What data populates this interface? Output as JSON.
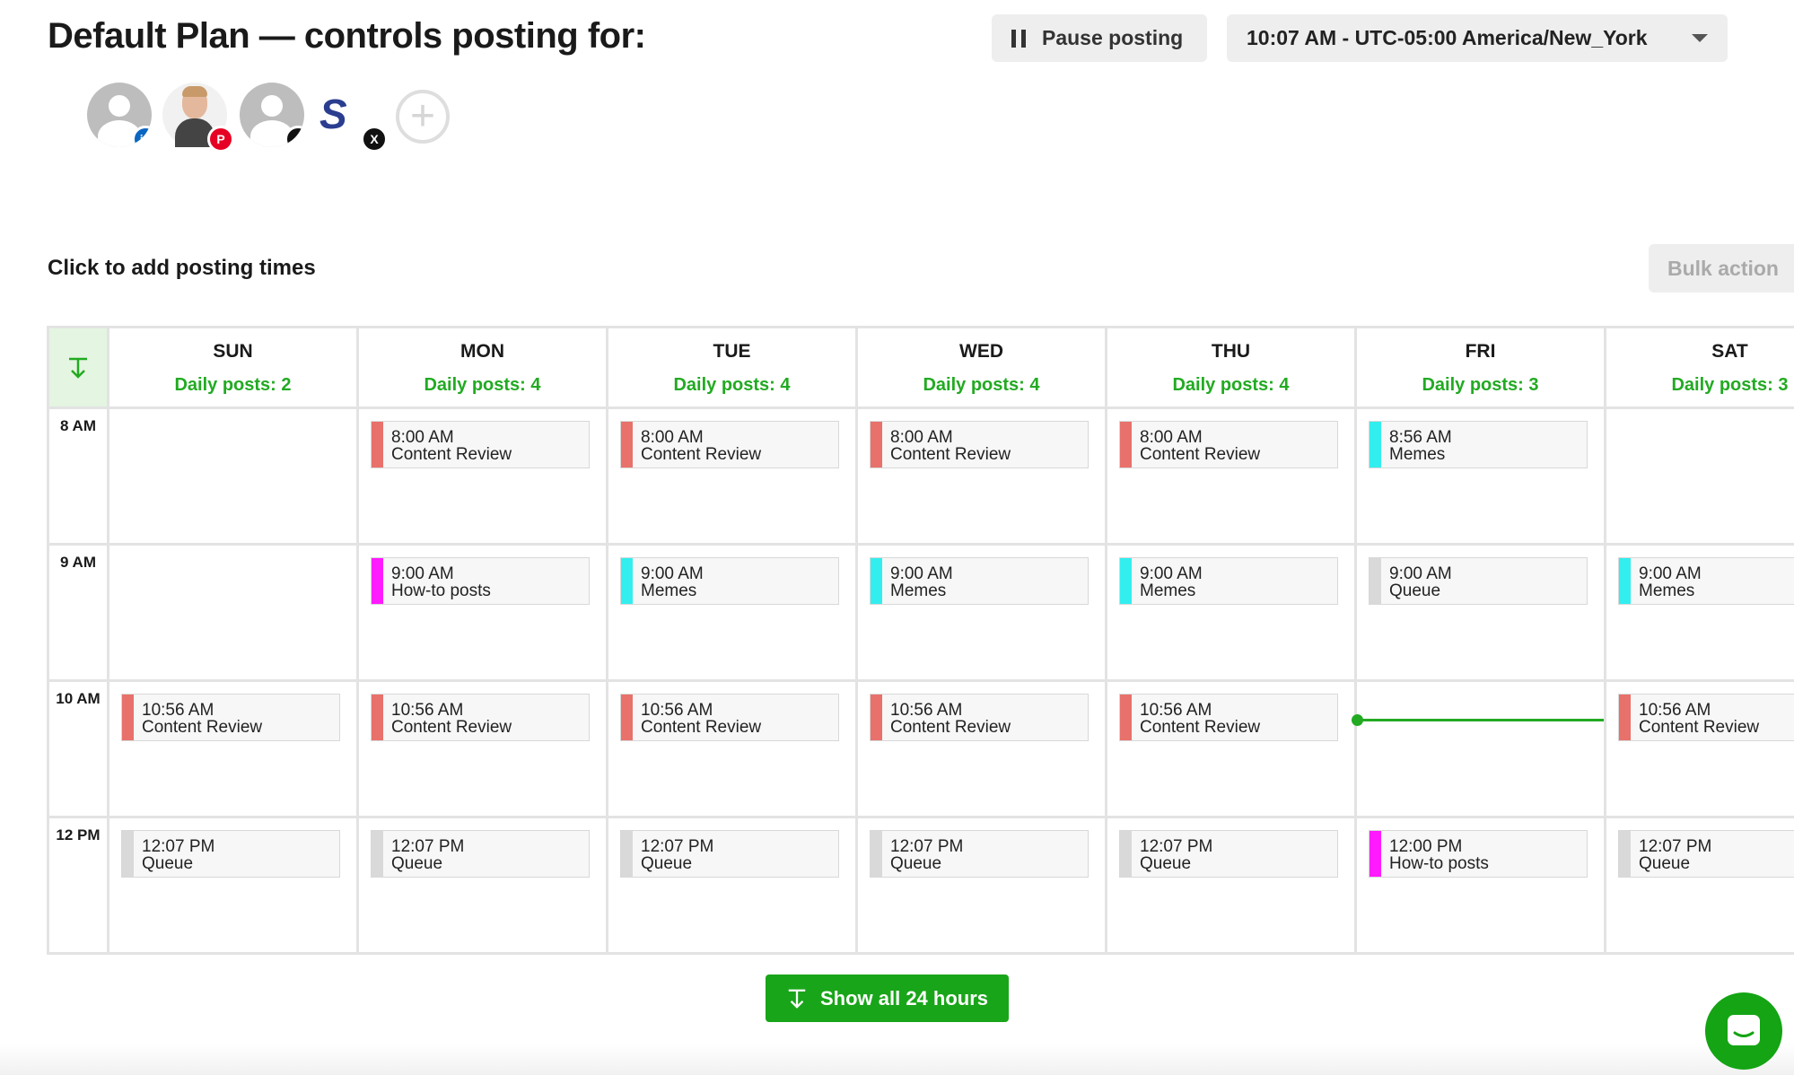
{
  "header": {
    "title": "Default Plan — controls posting for:",
    "pause_label": "Pause posting",
    "timezone": "10:07 AM - UTC-05:00 America/New_York"
  },
  "accounts": [
    {
      "kind": "generic",
      "network": "linkedin",
      "badge_text": "in",
      "badge_color": "#0a66c2"
    },
    {
      "kind": "photo",
      "network": "pinterest",
      "badge_text": "P",
      "badge_color": "#e60023"
    },
    {
      "kind": "generic",
      "network": "tiktok",
      "badge_text": "♪",
      "badge_color": "#111111"
    },
    {
      "kind": "logo",
      "network": "x",
      "badge_text": "X",
      "badge_color": "#111111"
    }
  ],
  "subtitle": "Click to add posting times",
  "bulk_label": "Bulk action",
  "hours": [
    "8 AM",
    "9 AM",
    "10 AM",
    "12 PM"
  ],
  "days": [
    {
      "name": "SUN",
      "daily": "Daily posts: 2",
      "slots": [
        null,
        null,
        {
          "time": "10:56 AM",
          "label": "Content Review",
          "color": "#e8716b"
        },
        {
          "time": "12:07 PM",
          "label": "Queue",
          "color": "#d9d9d9"
        }
      ]
    },
    {
      "name": "MON",
      "daily": "Daily posts: 4",
      "slots": [
        {
          "time": "8:00 AM",
          "label": "Content Review",
          "color": "#e8716b"
        },
        {
          "time": "9:00 AM",
          "label": "How-to posts",
          "color": "#ff1aff"
        },
        {
          "time": "10:56 AM",
          "label": "Content Review",
          "color": "#e8716b"
        },
        {
          "time": "12:07 PM",
          "label": "Queue",
          "color": "#d9d9d9"
        }
      ]
    },
    {
      "name": "TUE",
      "daily": "Daily posts: 4",
      "slots": [
        {
          "time": "8:00 AM",
          "label": "Content Review",
          "color": "#e8716b"
        },
        {
          "time": "9:00 AM",
          "label": "Memes",
          "color": "#33eeee"
        },
        {
          "time": "10:56 AM",
          "label": "Content Review",
          "color": "#e8716b"
        },
        {
          "time": "12:07 PM",
          "label": "Queue",
          "color": "#d9d9d9"
        }
      ]
    },
    {
      "name": "WED",
      "daily": "Daily posts: 4",
      "slots": [
        {
          "time": "8:00 AM",
          "label": "Content Review",
          "color": "#e8716b"
        },
        {
          "time": "9:00 AM",
          "label": "Memes",
          "color": "#33eeee"
        },
        {
          "time": "10:56 AM",
          "label": "Content Review",
          "color": "#e8716b"
        },
        {
          "time": "12:07 PM",
          "label": "Queue",
          "color": "#d9d9d9"
        }
      ]
    },
    {
      "name": "THU",
      "daily": "Daily posts: 4",
      "slots": [
        {
          "time": "8:00 AM",
          "label": "Content Review",
          "color": "#e8716b"
        },
        {
          "time": "9:00 AM",
          "label": "Memes",
          "color": "#33eeee"
        },
        {
          "time": "10:56 AM",
          "label": "Content Review",
          "color": "#e8716b"
        },
        {
          "time": "12:07 PM",
          "label": "Queue",
          "color": "#d9d9d9"
        }
      ]
    },
    {
      "name": "FRI",
      "daily": "Daily posts: 3",
      "slots": [
        {
          "time": "8:56 AM",
          "label": "Memes",
          "color": "#33eeee"
        },
        {
          "time": "9:00 AM",
          "label": "Queue",
          "color": "#d9d9d9"
        },
        null,
        {
          "time": "12:00 PM",
          "label": "How-to posts",
          "color": "#ff1aff"
        }
      ]
    },
    {
      "name": "SAT",
      "daily": "Daily posts: 3",
      "slots": [
        null,
        {
          "time": "9:00 AM",
          "label": "Memes",
          "color": "#33eeee"
        },
        {
          "time": "10:56 AM",
          "label": "Content Review",
          "color": "#e8716b"
        },
        {
          "time": "12:07 PM",
          "label": "Queue",
          "color": "#d9d9d9"
        }
      ]
    }
  ],
  "show_all_label": "Show all 24 hours",
  "colors": {
    "accent_green": "#22aa22",
    "button_green": "#19a519"
  }
}
